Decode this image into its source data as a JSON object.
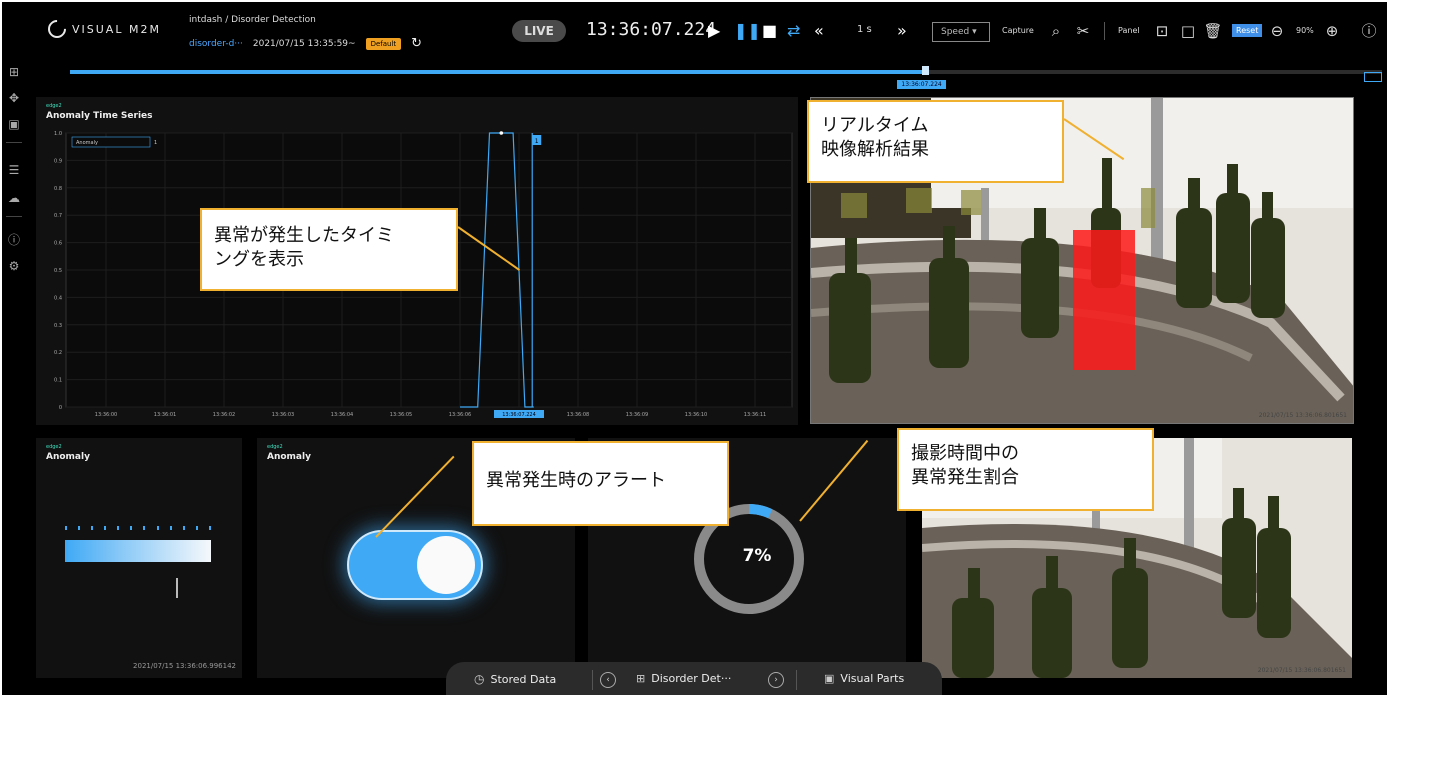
{
  "header": {
    "logo_text": "VISUAL M2M",
    "breadcrumb": "intdash / Disorder Detection",
    "measurement_name": "disorder-d···",
    "measurement_time": "2021/07/15 13:35:59~",
    "badge": "Default",
    "live_label": "LIVE",
    "clock": "13:36:07.224",
    "step": "1 s",
    "speed_label": "Speed",
    "capture_label": "Capture",
    "panel_label": "Panel",
    "reset_label": "Reset",
    "zoom": "90%"
  },
  "timeline": {
    "progress": 0.652,
    "current_label": "13:36:07.224"
  },
  "panels": {
    "timeseries": {
      "edge": "edge2",
      "title": "Anomaly Time Series",
      "legend": "Anomaly",
      "legend_value": "1",
      "cursor_label": "1",
      "current_label": "13:36:07.224"
    },
    "bar": {
      "edge": "edge2",
      "title": "Anomaly",
      "timestamp": "2021/07/15 13:36:06.996142"
    },
    "toggle": {
      "edge": "edge2",
      "title": "Anomaly",
      "state": "on"
    },
    "donut": {
      "value_label": "7%",
      "percent": 7
    },
    "video_top": {
      "timestamp": "2021/07/15 13:36:06.801651"
    },
    "video_bottom": {
      "timestamp": "2021/07/15 13:36:06.801651"
    }
  },
  "callouts": {
    "realtime": [
      "リアルタイム",
      "映像解析結果"
    ],
    "timing": [
      "異常が発生したタイミ",
      "ングを表示"
    ],
    "alert": [
      "異常発生時のアラート"
    ],
    "ratio": [
      "撮影時間中の",
      "異常発生割合"
    ]
  },
  "bottom_nav": {
    "stored": "Stored Data",
    "current": "Disorder Det···",
    "visual_parts": "Visual Parts"
  },
  "chart_data": {
    "type": "line",
    "title": "Anomaly Time Series",
    "series": [
      {
        "name": "Anomaly",
        "x": [
          "13:36:06.000",
          "13:36:06.300",
          "13:36:06.500",
          "13:36:06.700",
          "13:36:06.900",
          "13:36:07.100",
          "13:36:07.250"
        ],
        "y": [
          0,
          0,
          1,
          1,
          1,
          0,
          0
        ]
      }
    ],
    "x_tick_labels": [
      "13:36:00",
      "13:36:01",
      "13:36:02",
      "13:36:03",
      "13:36:04",
      "13:36:05",
      "13:36:06",
      "13:36:07.224",
      "13:36:08",
      "13:36:09",
      "13:36:10",
      "13:36:11"
    ],
    "y_tick_labels": [
      "0",
      "0.1",
      "0.2",
      "0.3",
      "0.4",
      "0.5",
      "0.6",
      "0.7",
      "0.8",
      "0.9",
      "1.0"
    ],
    "ylim": [
      0,
      1
    ],
    "grid": true,
    "legend": "top-left"
  },
  "colors": {
    "accent": "#3fa9f5",
    "callout_border": "#f0b030",
    "anomaly_box": "#ff1a1a"
  }
}
